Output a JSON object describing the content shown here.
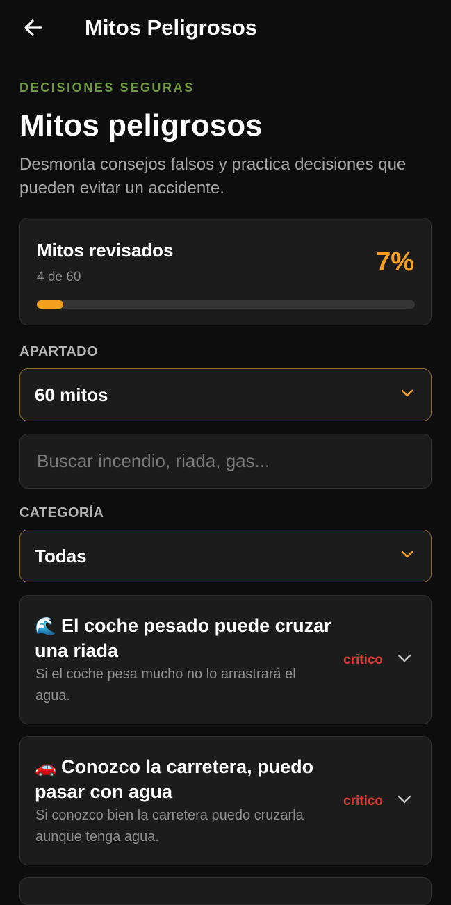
{
  "appbar": {
    "title": "Mitos Peligrosos"
  },
  "header": {
    "eyebrow": "DECISIONES SEGURAS",
    "title": "Mitos peligrosos",
    "subtitle": "Desmonta consejos falsos y practica decisiones que pueden evitar un accidente."
  },
  "progress": {
    "title": "Mitos revisados",
    "count": "4 de 60",
    "percent_label": "7%",
    "fraction": 0.07
  },
  "apartado": {
    "label": "APARTADO",
    "value": "60 mitos"
  },
  "search": {
    "placeholder": "Buscar incendio, riada, gas..."
  },
  "categoria": {
    "label": "CATEGORÍA",
    "value": "Todas"
  },
  "myths": [
    {
      "icon": "🌊",
      "icon_name": "water-wave-icon",
      "title": "El coche pesado puede cruzar una riada",
      "description": "Si el coche pesa mucho no lo arrastrará el agua.",
      "badge": "critico"
    },
    {
      "icon": "🚗",
      "icon_name": "car-icon",
      "title": "Conozco la carretera, puedo pasar con agua",
      "description": "Si conozco bien la carretera puedo cruzarla aunque tenga agua.",
      "badge": "critico"
    }
  ],
  "colors": {
    "accent": "#f5a020",
    "eyebrow": "#6f9a3c",
    "critical": "#e03a30",
    "background": "#0d0d0d",
    "card": "#1c1c1c"
  }
}
